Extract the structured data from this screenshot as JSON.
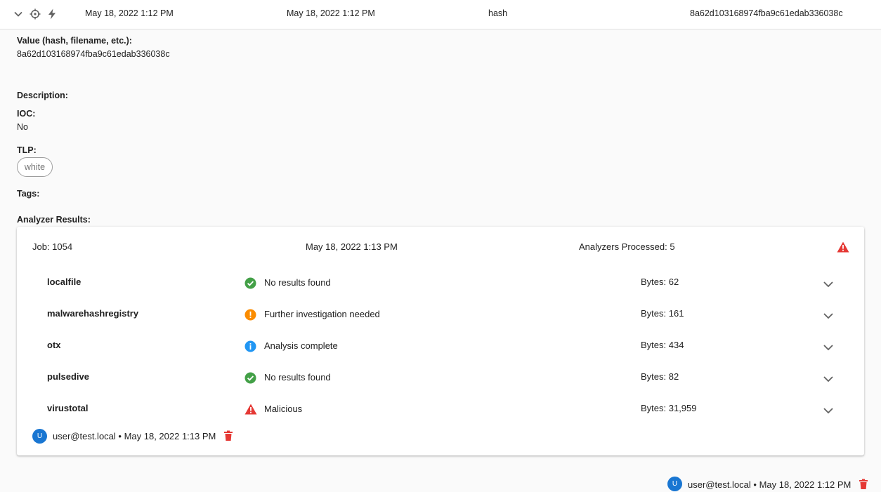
{
  "header": {
    "created": "May 18, 2022 1:12 PM",
    "modified": "May 18, 2022 1:12 PM",
    "type": "hash",
    "value": "8a62d103168974fba9c61edab336038c"
  },
  "details": {
    "value_label": "Value (hash, filename, etc.):",
    "value": "8a62d103168974fba9c61edab336038c",
    "description_label": "Description:",
    "ioc_label": "IOC:",
    "ioc_value": "No",
    "tlp_label": "TLP:",
    "tlp_value": "white",
    "tags_label": "Tags:",
    "analyzer_label": "Analyzer Results:"
  },
  "job": {
    "id_text": "Job: 1054",
    "date": "May 18, 2022 1:13 PM",
    "processed": "Analyzers Processed: 5",
    "results": [
      {
        "name": "localfile",
        "status": "No results found",
        "icon": "check-circle-icon",
        "bytes": "Bytes: 62"
      },
      {
        "name": "malwarehashregistry",
        "status": "Further investigation needed",
        "icon": "exclamation-circle-icon",
        "bytes": "Bytes: 161"
      },
      {
        "name": "otx",
        "status": "Analysis complete",
        "icon": "info-circle-icon",
        "bytes": "Bytes: 434"
      },
      {
        "name": "pulsedive",
        "status": "No results found",
        "icon": "check-circle-icon",
        "bytes": "Bytes: 82"
      },
      {
        "name": "virustotal",
        "status": "Malicious",
        "icon": "warning-triangle-icon",
        "bytes": "Bytes: 31,959"
      }
    ],
    "footer": {
      "avatar": "U",
      "text": "user@test.local • May 18, 2022 1:13 PM"
    }
  },
  "footer": {
    "avatar": "U",
    "text": "user@test.local • May 18, 2022 1:12 PM"
  },
  "colors": {
    "success": "#43a047",
    "warning": "#fb8c00",
    "info": "#2196f3",
    "error": "#e53935",
    "avatar": "#1976d2"
  }
}
